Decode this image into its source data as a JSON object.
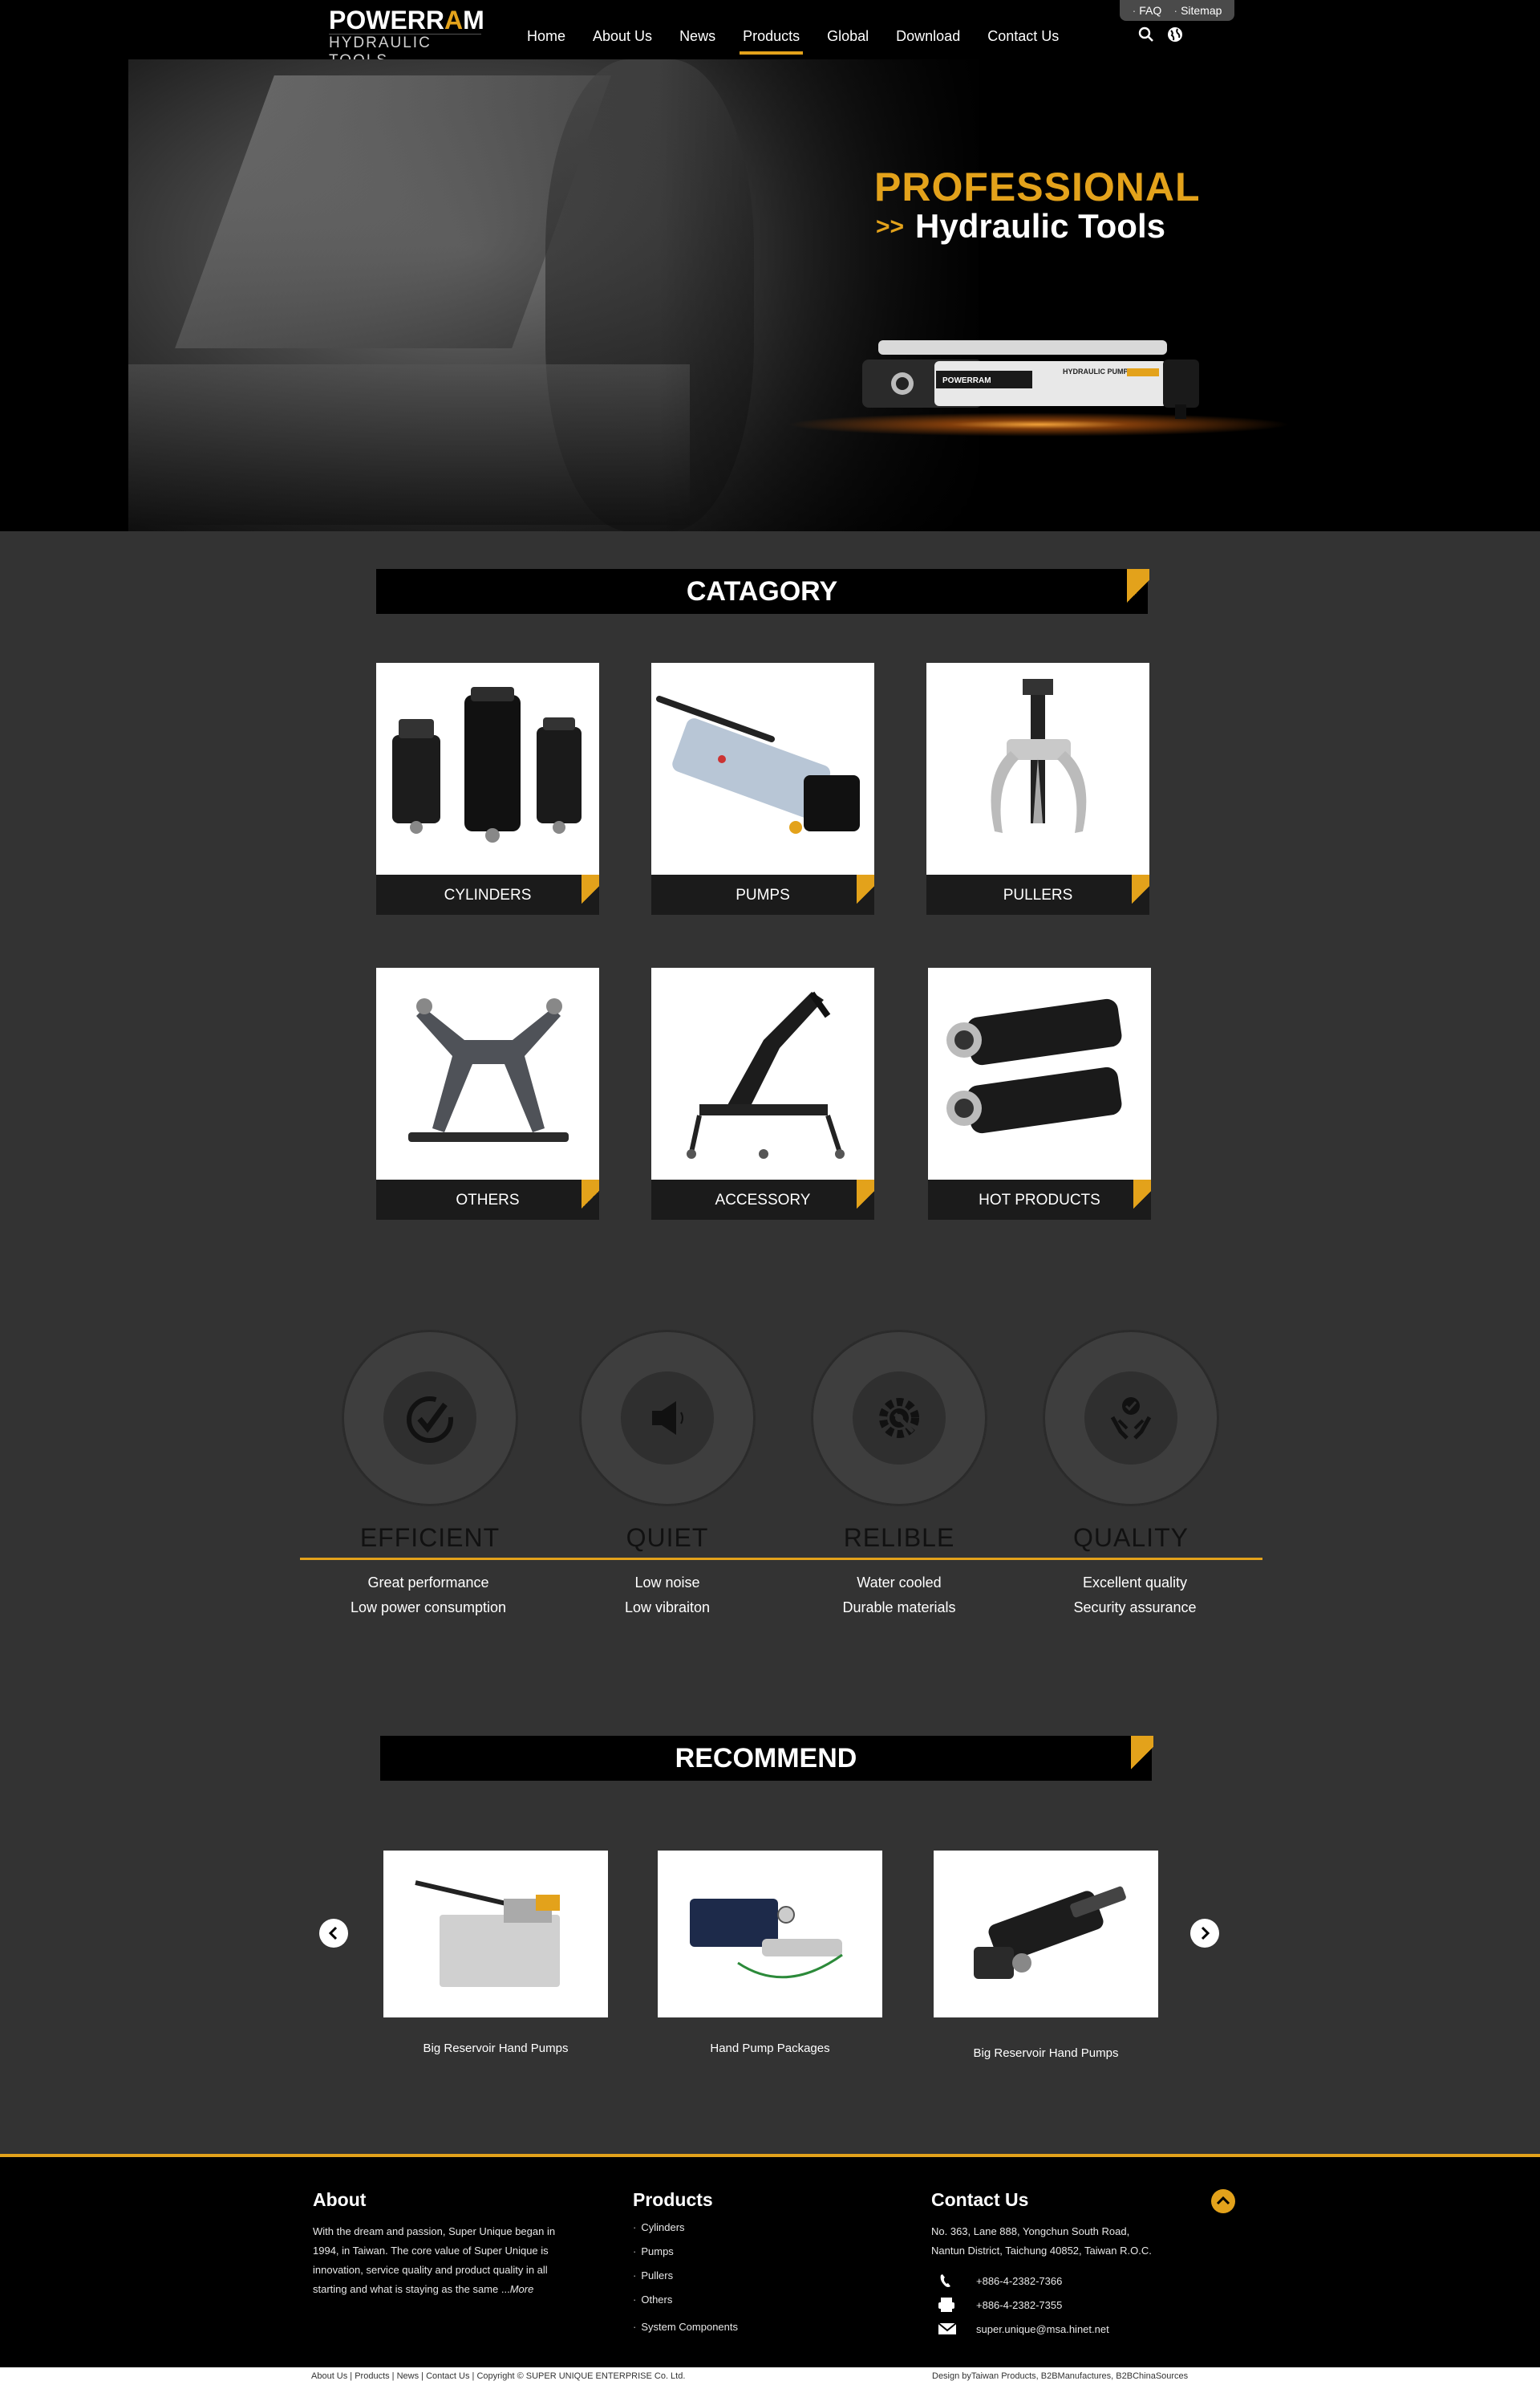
{
  "header": {
    "logo_brand_1": "POWERR",
    "logo_brand_2": "A",
    "logo_brand_3": "M",
    "logo_sub": "HYDRAULIC TOOLS",
    "nav": [
      "Home",
      "About Us",
      "News",
      "Products",
      "Global",
      "Download",
      "Contact Us"
    ],
    "active_nav": "Products",
    "topbar": {
      "faq": "FAQ",
      "sitemap": "Sitemap"
    }
  },
  "hero": {
    "title_1": "PROFESSIONAL",
    "arrow": ">>",
    "title_2": "Hydraulic Tools",
    "pump_brand": "POWERRAM",
    "pump_label": "HYDRAULIC PUMP"
  },
  "category": {
    "title": "CATAGORY",
    "items": [
      "CYLINDERS",
      "PUMPS",
      "PULLERS",
      "OTHERS",
      "ACCESSORY",
      "HOT PRODUCTS"
    ]
  },
  "features": [
    {
      "name": "EFFICIENT",
      "line1": "Great performance",
      "line2": "Low power consumption",
      "icon": "check-gauge-icon"
    },
    {
      "name": "QUIET",
      "line1": "Low noise",
      "line2": "Low vibraiton",
      "icon": "speaker-icon"
    },
    {
      "name": "RELIBLE",
      "line1": "Water cooled",
      "line2": "Durable materials",
      "icon": "gear-wrench-icon"
    },
    {
      "name": "QUALITY",
      "line1": "Excellent quality",
      "line2": "Security assurance",
      "icon": "hands-check-icon"
    }
  ],
  "recommend": {
    "title": "RECOMMEND",
    "items": [
      "Big Reservoir Hand Pumps",
      "Hand Pump Packages",
      "Big Reservoir Hand Pumps"
    ]
  },
  "footer": {
    "about_title": "About",
    "about_text": "With the dream and passion, Super Unique began in 1994, in Taiwan. The core value of Super Unique is innovation, service quality and product quality in all starting and what is staying as the same ...",
    "about_more": "More",
    "products_title": "Products",
    "products": [
      "Cylinders",
      "Pumps",
      "Pullers",
      "Others",
      "System Components"
    ],
    "contact_title": "Contact Us",
    "address_1": "No. 363, Lane 888, Yongchun South Road,",
    "address_2": "Nantun District, Taichung 40852, Taiwan R.O.C.",
    "phone": "+886-4-2382-7366",
    "fax": "+886-4-2382-7355",
    "email": "super.unique@msa.hinet.net",
    "copy_left": "About Us | Products | News | Contact Us |   Copyright © SUPER UNIQUE ENTERPRISE Co. Ltd.",
    "copy_right": "Design byTaiwan Products, B2BManufactures, B2BChinaSources"
  },
  "colors": {
    "accent": "#e3a21b",
    "background": "#333333",
    "header": "#000000"
  }
}
